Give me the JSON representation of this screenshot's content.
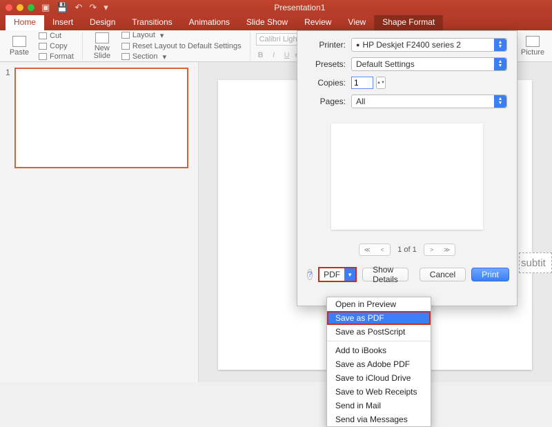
{
  "title": "Presentation1",
  "tabs": {
    "home": "Home",
    "insert": "Insert",
    "design": "Design",
    "transitions": "Transitions",
    "animations": "Animations",
    "slideshow": "Slide Show",
    "review": "Review",
    "view": "View",
    "shapeformat": "Shape Format"
  },
  "ribbon": {
    "paste": "Paste",
    "cut": "Cut",
    "copy": "Copy",
    "format": "Format",
    "newslide": "New\nSlide",
    "layout": "Layout",
    "reset": "Reset Layout to Default Settings",
    "section": "Section",
    "font_name": "Calibri Light (Headi",
    "bold": "B",
    "italic": "I",
    "underline": "U",
    "strike": "abc",
    "picture": "Picture"
  },
  "thumbs": {
    "num": "1"
  },
  "slide": {
    "subtitle": "subtit"
  },
  "print": {
    "printer_label": "Printer:",
    "printer_value": "HP Deskjet F2400 series 2",
    "printer_icon": "●",
    "presets_label": "Presets:",
    "presets_value": "Default Settings",
    "copies_label": "Copies:",
    "copies_value": "1",
    "pages_label": "Pages:",
    "pages_value": "All",
    "pager_text": "1 of 1",
    "help": "?",
    "pdf_label": "PDF",
    "show_details": "Show Details",
    "cancel": "Cancel",
    "print_btn": "Print"
  },
  "pdf_menu": {
    "open_preview": "Open in Preview",
    "save_as_pdf": "Save as PDF",
    "save_as_ps": "Save as PostScript",
    "add_ibooks": "Add to iBooks",
    "save_adobe": "Save as Adobe PDF",
    "icloud": "Save to iCloud Drive",
    "web_receipts": "Save to Web Receipts",
    "mail": "Send in Mail",
    "messages": "Send via Messages"
  }
}
